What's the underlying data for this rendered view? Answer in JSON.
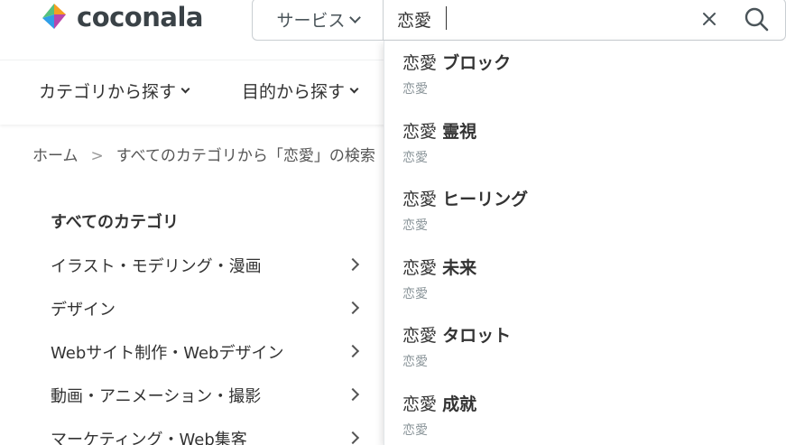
{
  "header": {
    "logo_text": "coconala",
    "service_select": "サービス",
    "search_value": "恋愛",
    "clear_icon": "close-icon",
    "search_icon": "search-icon"
  },
  "nav": {
    "items": [
      {
        "label": "カテゴリから探す"
      },
      {
        "label": "目的から探す"
      }
    ]
  },
  "breadcrumb": {
    "home": "ホーム",
    "separator": ">",
    "current": "すべてのカテゴリから「恋愛」の検索"
  },
  "categories": {
    "title": "すべてのカテゴリ",
    "items": [
      {
        "label": "イラスト・モデリング・漫画"
      },
      {
        "label": "デザイン"
      },
      {
        "label": "Webサイト制作・Webデザイン"
      },
      {
        "label": "動画・アニメーション・撮影"
      },
      {
        "label": "マーケティング・Web集客"
      }
    ]
  },
  "suggestions": [
    {
      "prefix": "恋愛",
      "suffix": "ブロック",
      "sub": "恋愛"
    },
    {
      "prefix": "恋愛",
      "suffix": "霊視",
      "sub": "恋愛"
    },
    {
      "prefix": "恋愛",
      "suffix": "ヒーリング",
      "sub": "恋愛"
    },
    {
      "prefix": "恋愛",
      "suffix": "未来",
      "sub": "恋愛"
    },
    {
      "prefix": "恋愛",
      "suffix": "タロット",
      "sub": "恋愛"
    },
    {
      "prefix": "恋愛",
      "suffix": "成就",
      "sub": "恋愛"
    }
  ],
  "colors": {
    "logo_orange": "#f6a020",
    "logo_pink": "#ec3f7c",
    "logo_blue": "#2f9ee8",
    "logo_green": "#56c17e",
    "text": "#333333",
    "sub_text": "#8a9499"
  }
}
